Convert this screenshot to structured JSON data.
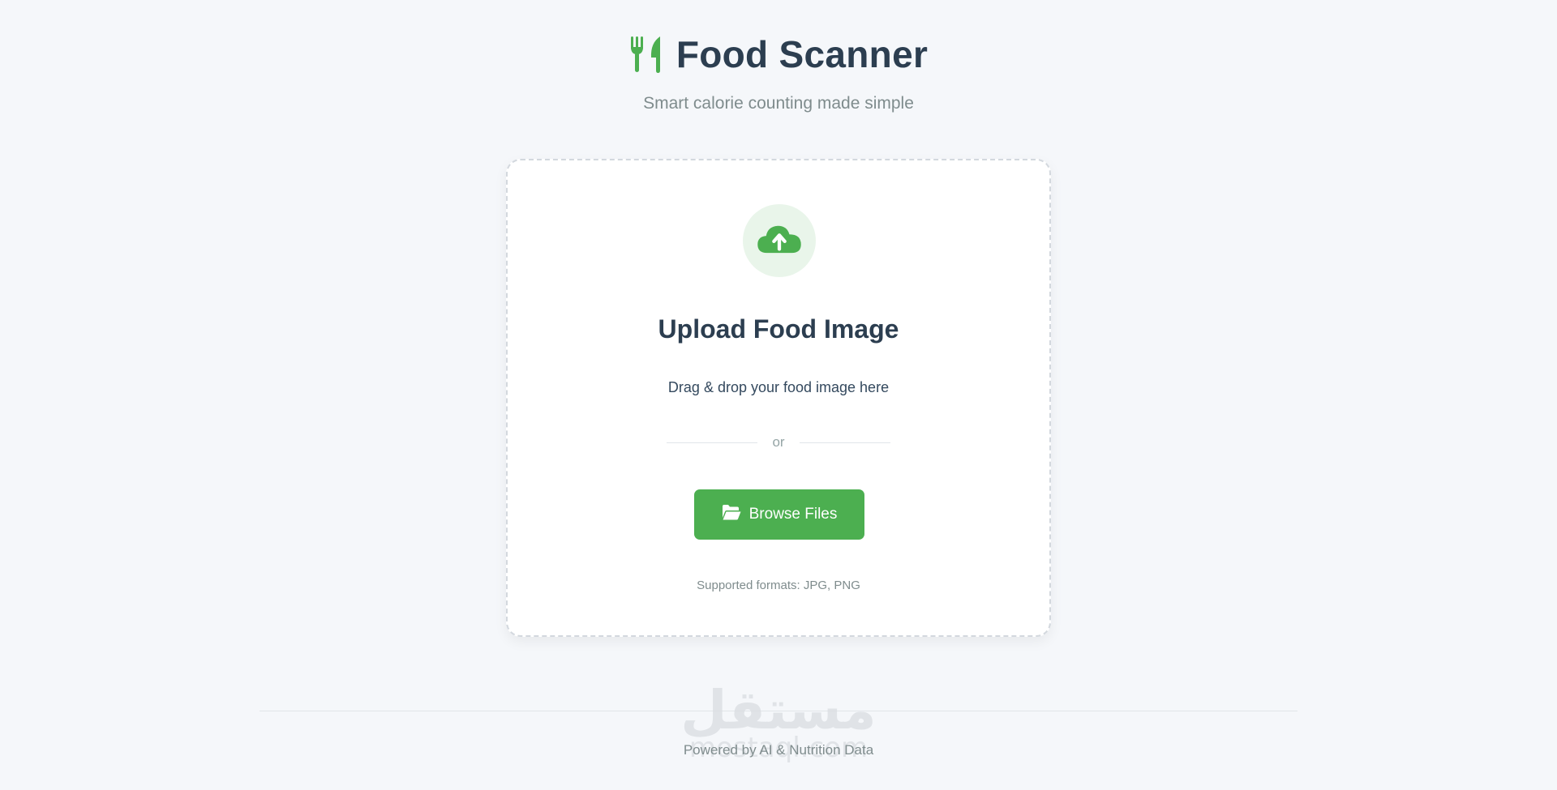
{
  "header": {
    "title": "Food Scanner",
    "subtitle": "Smart calorie counting made simple",
    "logo_icon": "utensils-icon"
  },
  "upload": {
    "icon": "cloud-upload-icon",
    "title": "Upload Food Image",
    "instruction": "Drag & drop your food image here",
    "divider_text": "or",
    "browse_label": "Browse Files",
    "browse_icon": "folder-open-icon",
    "formats": "Supported formats: JPG, PNG"
  },
  "footer": {
    "text": "Powered by AI & Nutrition Data",
    "watermark_ar": "مستقل",
    "watermark_en": "mostaql.com"
  },
  "colors": {
    "accent": "#4caf50",
    "background": "#f5f7fa",
    "title": "#2c3e50",
    "muted": "#7f8c8d"
  }
}
